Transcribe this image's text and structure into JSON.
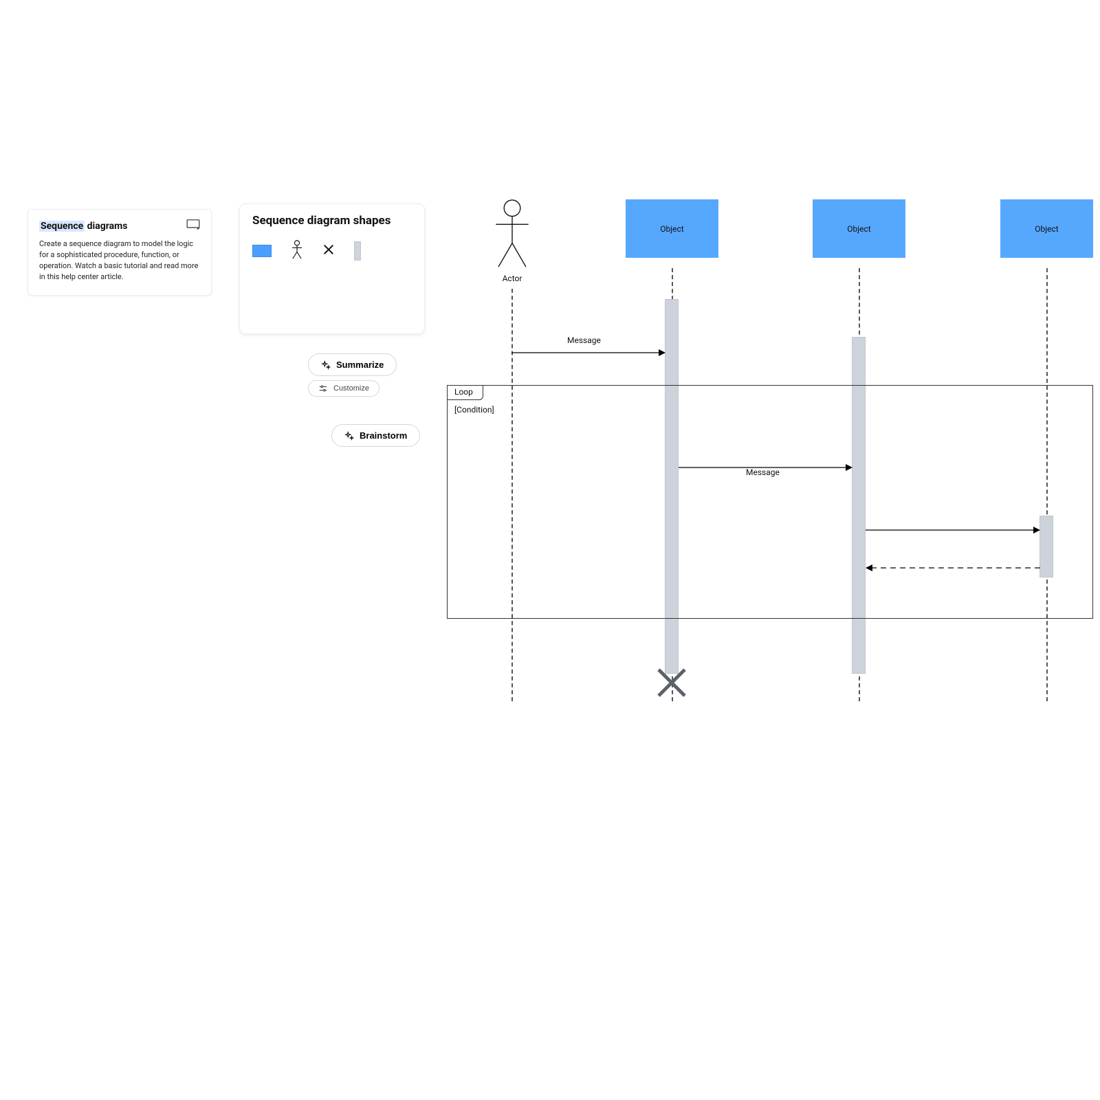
{
  "info": {
    "title_hl": "Sequence",
    "title_rest": " diagrams",
    "body": "Create a sequence diagram to model the logic for a sophisticated procedure, function, or operation. Watch a basic tutorial and read more in this help center article."
  },
  "shapes": {
    "title": "Sequence diagram shapes"
  },
  "actions": {
    "summarize": "Summarize",
    "customize": "Customize",
    "brainstorm": "Brainstorm"
  },
  "diagram": {
    "actor_label": "Actor",
    "object_label": "Object",
    "message_label": "Message",
    "loop_label": "Loop",
    "condition_label": "[Condition]"
  }
}
